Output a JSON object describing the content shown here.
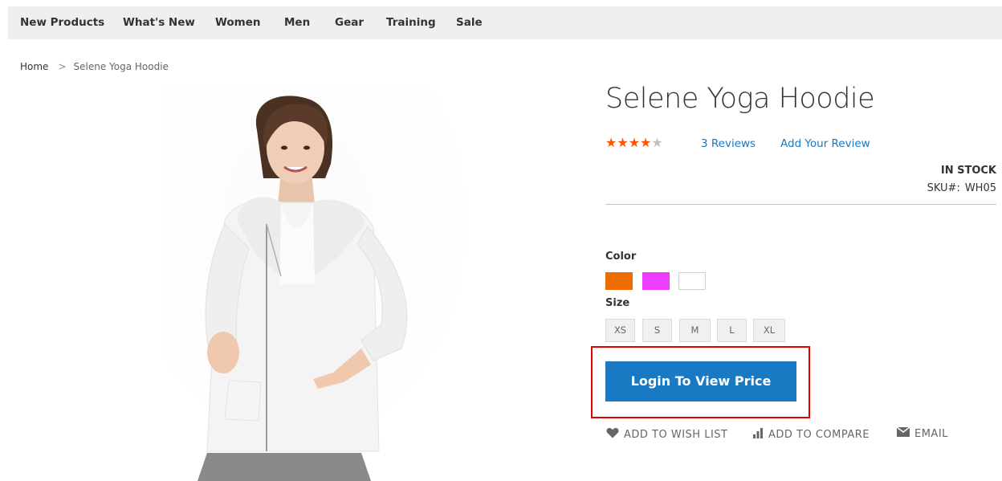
{
  "nav": {
    "items": [
      "New Products",
      "What's New",
      "Women",
      "Men",
      "Gear",
      "Training",
      "Sale"
    ]
  },
  "breadcrumb": {
    "home": "Home",
    "separator": ">",
    "current": "Selene Yoga Hoodie"
  },
  "product": {
    "title": "Selene Yoga Hoodie",
    "rating": 4,
    "rating_max": 5,
    "reviews_link": "3 Reviews",
    "add_review_link": "Add Your Review",
    "stock": "IN STOCK",
    "sku_label": "SKU#:",
    "sku_value": "WH05",
    "image_icon": "hoodie-model-image"
  },
  "options": {
    "color_label": "Color",
    "colors": [
      "#ef6c00",
      "#ef3dff",
      "#ffffff"
    ],
    "size_label": "Size",
    "sizes": [
      "XS",
      "S",
      "M",
      "L",
      "XL"
    ]
  },
  "cta": {
    "login_label": "Login To View Price"
  },
  "actions": {
    "wishlist": "ADD TO WISH LIST",
    "compare": "ADD TO COMPARE",
    "email": "EMAIL"
  },
  "colors": {
    "link": "#1979c3",
    "button": "#1979c3",
    "star": "#ff5501",
    "highlight": "#e10000"
  }
}
